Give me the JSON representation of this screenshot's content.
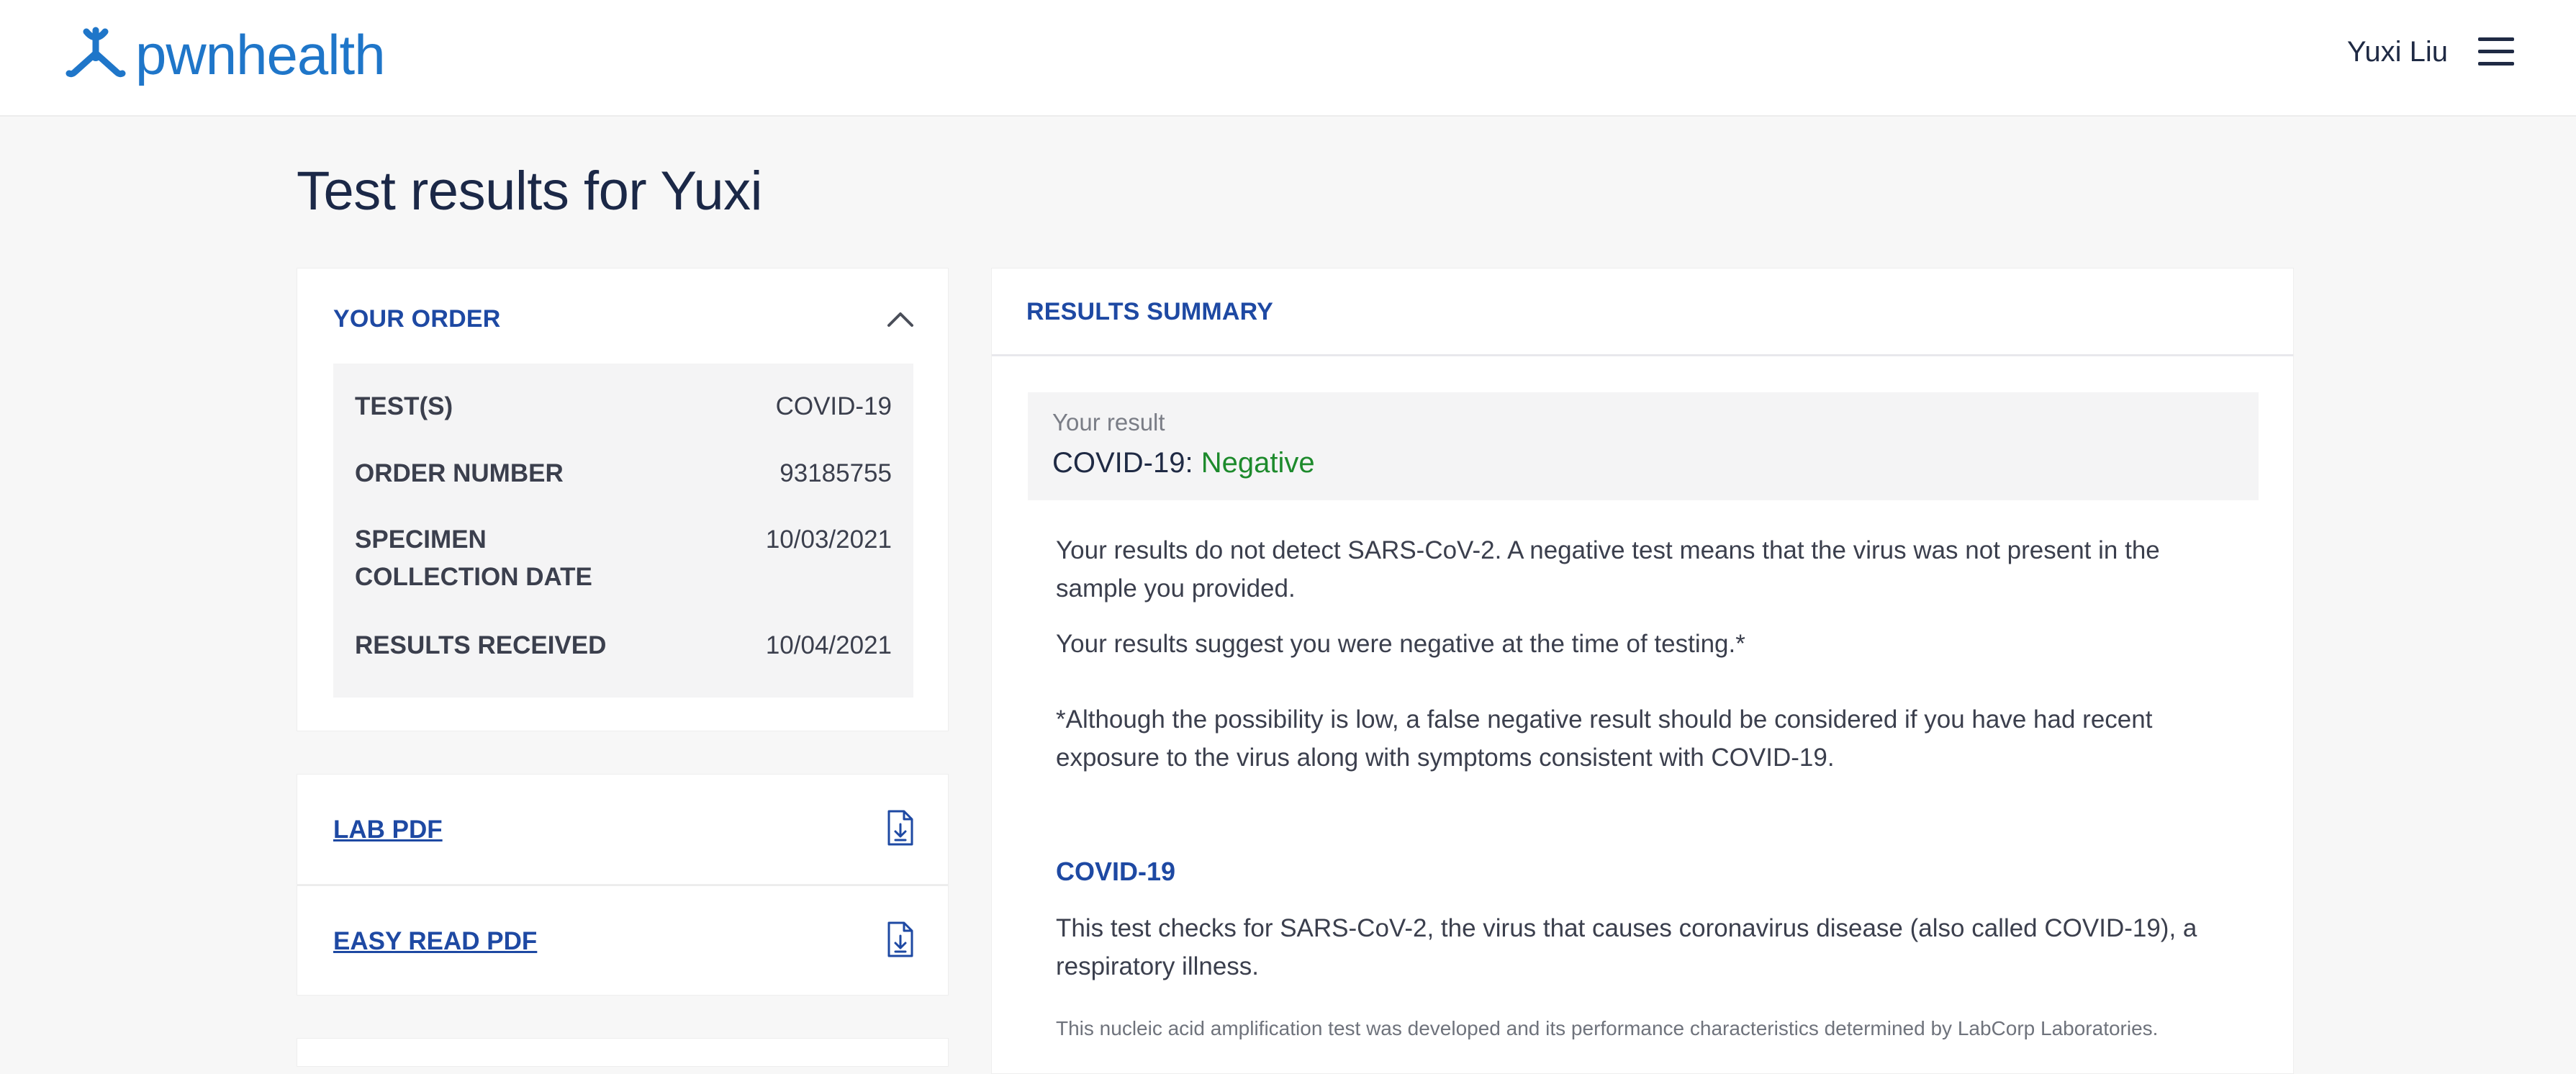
{
  "header": {
    "logo_text": "pwnhealth",
    "user_name": "Yuxi Liu",
    "brand_color": "#1f76c9",
    "menu_icon": "hamburger-menu-icon"
  },
  "page": {
    "title": "Test results for Yuxi"
  },
  "order": {
    "heading": "YOUR ORDER",
    "collapse_icon": "chevron-up-icon",
    "rows": [
      {
        "label": "TEST(S)",
        "value": "COVID-19"
      },
      {
        "label": "ORDER NUMBER",
        "value": "93185755"
      },
      {
        "label": "SPECIMEN COLLECTION DATE",
        "value": "10/03/2021"
      },
      {
        "label": "RESULTS RECEIVED",
        "value": "10/04/2021"
      }
    ]
  },
  "downloads": [
    {
      "label": "LAB PDF",
      "icon": "download-file-icon"
    },
    {
      "label": "EASY READ PDF",
      "icon": "download-file-icon"
    }
  ],
  "results": {
    "heading": "RESULTS SUMMARY",
    "your_result_label": "Your result",
    "test_name": "COVID-19:",
    "status": "Negative",
    "status_color": "#1d8a2c",
    "paragraph_1": "Your results do not detect SARS-CoV-2. A negative test means that the virus was not present in the sample you provided.",
    "paragraph_2": "Your results suggest you were negative at the time of testing.*",
    "paragraph_3": "*Although the possibility is low, a false negative result should be considered if you have had recent exposure to the virus along with symptoms consistent with COVID-19.",
    "covid_heading": "COVID-19",
    "covid_description": "This test checks for SARS-CoV-2, the virus that causes coronavirus disease (also called COVID-19), a respiratory illness.",
    "lab_note": "This nucleic acid amplification test was developed and its performance characteristics determined by LabCorp Laboratories."
  }
}
